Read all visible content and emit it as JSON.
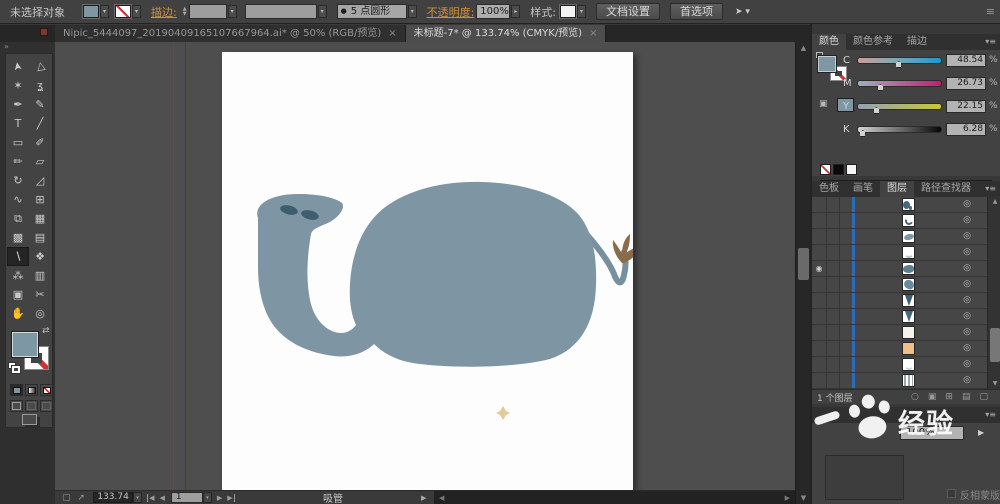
{
  "control_bar": {
    "status": "未选择对象",
    "stroke_label": "描边:",
    "brush_bullet": "●",
    "brush_name": "5 点圆形",
    "opacity_label": "不透明度:",
    "opacity_value": "100%",
    "style_label": "样式:",
    "document_setup": "文档设置",
    "preferences": "首选项",
    "menu_icon": "≡"
  },
  "tab_bar": {
    "tabs": [
      {
        "title": "Nipic_5444097_20190409165107667964.ai* @ 50% (RGB/预览)",
        "close": "×",
        "active": false
      },
      {
        "title": "未标题-7* @ 133.74% (CMYK/预览)",
        "close": "×",
        "active": true
      }
    ]
  },
  "toolbar": {
    "collapse_icon": "»",
    "tools": [
      {
        "name": "selection",
        "glyph": "➤"
      },
      {
        "name": "direct-selection",
        "glyph": "▷"
      },
      {
        "name": "magic-wand",
        "glyph": "✶"
      },
      {
        "name": "lasso",
        "glyph": "ʓ"
      },
      {
        "name": "pen",
        "glyph": "✒"
      },
      {
        "name": "curvature",
        "glyph": "✎"
      },
      {
        "name": "type",
        "glyph": "T"
      },
      {
        "name": "line-segment",
        "glyph": "╱"
      },
      {
        "name": "rectangle",
        "glyph": "▭"
      },
      {
        "name": "paintbrush",
        "glyph": "✐"
      },
      {
        "name": "pencil",
        "glyph": "✏"
      },
      {
        "name": "eraser",
        "glyph": "▱"
      },
      {
        "name": "rotate",
        "glyph": "↻"
      },
      {
        "name": "scale",
        "glyph": "◿"
      },
      {
        "name": "width",
        "glyph": "∿"
      },
      {
        "name": "free-transform",
        "glyph": "⊞"
      },
      {
        "name": "shape-builder",
        "glyph": "⧉"
      },
      {
        "name": "perspective-grid",
        "glyph": "▦"
      },
      {
        "name": "mesh",
        "glyph": "▩"
      },
      {
        "name": "gradient",
        "glyph": "▤"
      },
      {
        "name": "eyedropper",
        "glyph": "∖",
        "selected": true
      },
      {
        "name": "blend",
        "glyph": "❖"
      },
      {
        "name": "symbol-sprayer",
        "glyph": "⁂"
      },
      {
        "name": "column-graph",
        "glyph": "▥"
      },
      {
        "name": "artboard",
        "glyph": "▣"
      },
      {
        "name": "slice",
        "glyph": "✂"
      },
      {
        "name": "hand",
        "glyph": "✋"
      },
      {
        "name": "zoom",
        "glyph": "◎"
      }
    ]
  },
  "color_panel": {
    "tabs": [
      {
        "label": "颜色",
        "active": true
      },
      {
        "label": "颜色参考",
        "active": false
      },
      {
        "label": "描边",
        "active": false
      }
    ],
    "menu_icon": "▾≡",
    "channels": [
      {
        "label": "C",
        "value": "48.54",
        "pos": 48.5,
        "key": "c"
      },
      {
        "label": "M",
        "value": "26.73",
        "pos": 26.7,
        "key": "m"
      },
      {
        "label": "Y",
        "value": "22.15",
        "pos": 22.1,
        "key": "y"
      },
      {
        "label": "K",
        "value": "6.28",
        "pos": 6.3,
        "key": "k"
      }
    ],
    "percent": "%"
  },
  "layers_panel": {
    "tabs": [
      {
        "label": "色板",
        "active": false
      },
      {
        "label": "画笔",
        "active": false
      },
      {
        "label": "图层",
        "active": true
      },
      {
        "label": "路径查找器",
        "active": false
      }
    ],
    "menu_icon": "▾≡",
    "eye_icon": "◉",
    "target_icon": "◎",
    "eye_row": 4,
    "rows": [
      {
        "thumb": "halves"
      },
      {
        "thumb": "curve"
      },
      {
        "thumb": "leaf"
      },
      {
        "thumb": "arc"
      },
      {
        "thumb": "blob"
      },
      {
        "thumb": "blob2"
      },
      {
        "thumb": "vee"
      },
      {
        "thumb": "vee2"
      },
      {
        "thumb": "plain"
      },
      {
        "thumb": "square"
      },
      {
        "thumb": "arc2"
      },
      {
        "thumb": "bars"
      }
    ],
    "footer": {
      "count": "1 个图层",
      "icons": [
        {
          "name": "search-icon",
          "glyph": "○"
        },
        {
          "name": "clip-mask-icon",
          "glyph": "▣"
        },
        {
          "name": "new-sublayer-icon",
          "glyph": "⊞"
        },
        {
          "name": "new-layer-icon",
          "glyph": "▤"
        },
        {
          "name": "delete-layer-icon",
          "glyph": "▢"
        }
      ]
    }
  },
  "transparency_panel": {
    "menu_icon": "▾≡",
    "opacity_value": "100%",
    "arrow_icon": "▶",
    "invert_mask_label": "反相蒙版"
  },
  "status_bar": {
    "zoom_value": "133.74",
    "artboard_value": "1",
    "tool_name": "吸管"
  },
  "watermark": {
    "text": "经验"
  },
  "artwork": {
    "body_color": "#7E96A3",
    "nostril_color": "#3E5E70",
    "tail_color": "#76909E",
    "tuft_color": "#8A6B4A",
    "spark_color": "#E0C087"
  }
}
